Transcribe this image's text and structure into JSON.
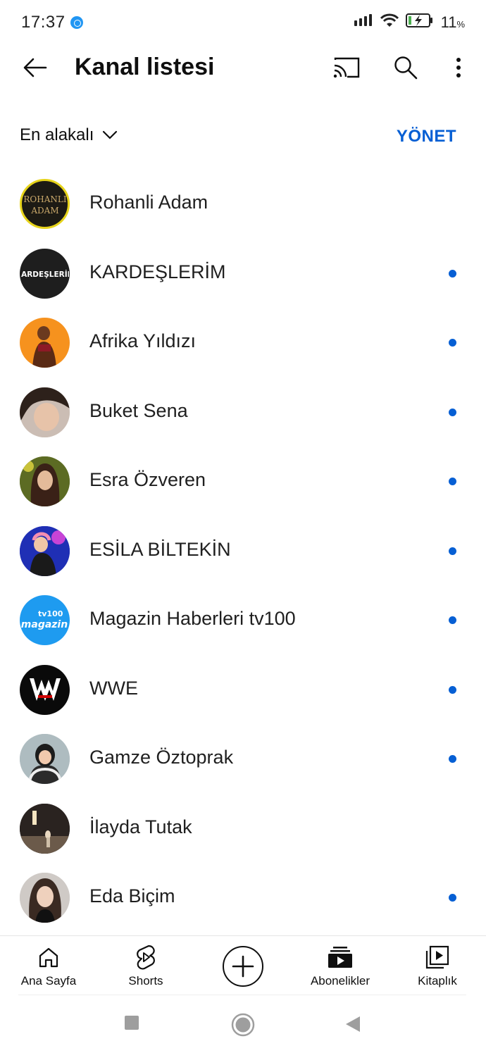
{
  "status_bar": {
    "time": "17:37",
    "battery": "11",
    "battery_unit": "%"
  },
  "top_bar": {
    "title": "Kanal listesi",
    "back_icon": "arrow-left-icon",
    "cast_icon": "cast-icon",
    "search_icon": "search-icon",
    "more_icon": "more-vert-icon"
  },
  "filter": {
    "sort_label": "En alakalı",
    "manage_label": "YÖNET"
  },
  "channels": [
    {
      "name": "Rohanli Adam",
      "has_new": false,
      "avatar_text": "ROHANLI ADAM"
    },
    {
      "name": "KARDEŞLERİM",
      "has_new": true,
      "avatar_text": "KARDEŞLERİM"
    },
    {
      "name": "Afrika Yıldızı",
      "has_new": true
    },
    {
      "name": "Buket Sena",
      "has_new": true
    },
    {
      "name": "Esra Özveren",
      "has_new": true
    },
    {
      "name": "ESİLA BİLTEKİN",
      "has_new": true
    },
    {
      "name": "Magazin Haberleri tv100",
      "has_new": true,
      "avatar_text": "tv100 magazin"
    },
    {
      "name": "WWE",
      "has_new": true
    },
    {
      "name": "Gamze Öztoprak",
      "has_new": true
    },
    {
      "name": "İlayda Tutak",
      "has_new": false
    },
    {
      "name": "Eda Biçim",
      "has_new": true
    }
  ],
  "bottom_nav": {
    "home": "Ana Sayfa",
    "shorts": "Shorts",
    "subscriptions": "Abonelikler",
    "library": "Kitaplık"
  },
  "colors": {
    "accent": "#065fd4"
  }
}
